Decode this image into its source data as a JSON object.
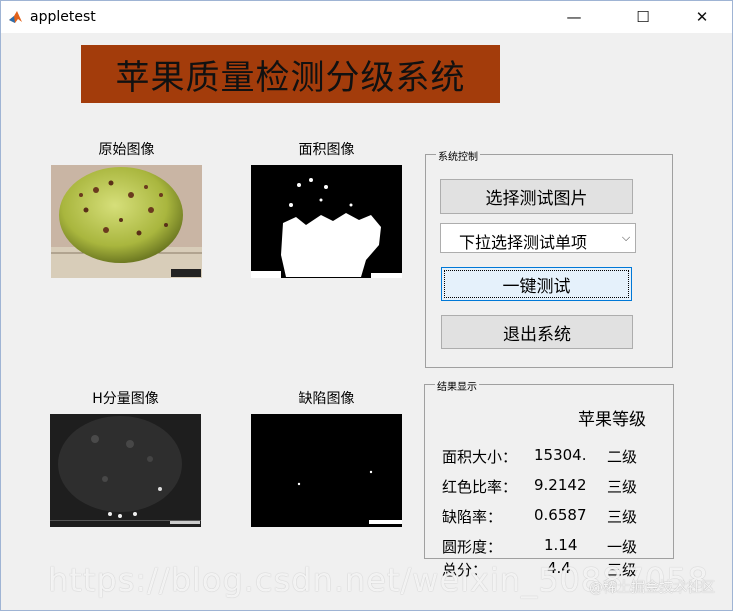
{
  "window": {
    "title": "appletest",
    "minimize": "—",
    "maximize": "☐",
    "close": "✕"
  },
  "header": {
    "title": "苹果质量检测分级系统"
  },
  "images": {
    "original_label": "原始图像",
    "area_label": "面积图像",
    "h_label": "H分量图像",
    "defect_label": "缺陷图像"
  },
  "control": {
    "legend": "系统控制",
    "select_image_label": "选择测试图片",
    "dropdown_value": "下拉选择测试单项",
    "one_click_label": "一键测试",
    "exit_label": "退出系统"
  },
  "results": {
    "legend": "结果显示",
    "grade_title": "苹果等级",
    "rows": [
      {
        "label": "面积大小：",
        "value": "15304.",
        "grade": "二级"
      },
      {
        "label": "红色比率：",
        "value": "9.2142",
        "grade": "三级"
      },
      {
        "label": "缺陷率：",
        "value": "0.6587",
        "grade": "三级"
      },
      {
        "label": "圆形度：",
        "value": "1.14",
        "grade": "一级"
      },
      {
        "label": "总分：",
        "value": "4.4",
        "grade": "三级"
      }
    ]
  },
  "watermark": {
    "main": "https://blog.csdn.net/weixin_50887058",
    "secondary": "@稀土掘金技术社区"
  },
  "colors": {
    "header_bg": "#a33c0b",
    "focus_border": "#0078d7"
  }
}
